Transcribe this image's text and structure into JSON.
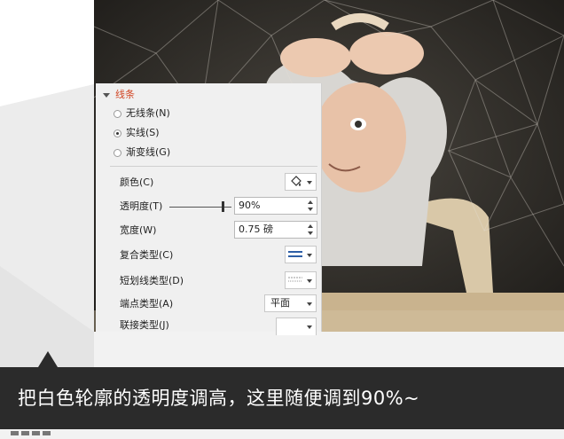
{
  "caption": "把白色轮廓的透明度调高，这里随便调到90%~",
  "pane": {
    "section_title": "线条",
    "line_options": [
      {
        "label": "无线条(N)",
        "selected": false
      },
      {
        "label": "实线(S)",
        "selected": true
      },
      {
        "label": "渐变线(G)",
        "selected": false
      }
    ],
    "color_label": "颜色(C)",
    "transparency_label": "透明度(T)",
    "transparency_value": "90%",
    "width_label": "宽度(W)",
    "width_value": "0.75 磅",
    "compound_label": "复合类型(C)",
    "dash_label": "短划线类型(D)",
    "cap_label": "端点类型(A)",
    "cap_value": "平面",
    "join_label": "联接类型(J)"
  },
  "colors": {
    "section_title": "#d24726",
    "caption_bg": "#2b2b2b",
    "accent_line": "#2e5fa6"
  }
}
